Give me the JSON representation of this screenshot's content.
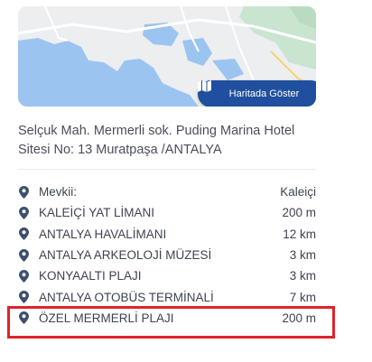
{
  "map": {
    "button_label": "Haritada Göster",
    "button_icon": "map-icon",
    "colors": {
      "water": "#9cc4f0",
      "land": "#eceef0",
      "green": "#c9e4cf",
      "button": "#1f4f9e"
    }
  },
  "address": {
    "line1": "Selçuk Mah. Mermerli sok. Puding Marina Hotel",
    "line2": "Sitesi No: 13 Muratpaşa /ANTALYA"
  },
  "locations": [
    {
      "name": "Mevkii:",
      "value": "Kaleiçi",
      "icon": "location-pin-icon"
    },
    {
      "name": "KALEİÇİ YAT LİMANI",
      "value": "200 m",
      "icon": "location-pin-icon"
    },
    {
      "name": "ANTALYA HAVALİMANI",
      "value": "12 km",
      "icon": "location-pin-icon"
    },
    {
      "name": "ANTALYA ARKEOLOJİ MÜZESİ",
      "value": "3 km",
      "icon": "location-pin-icon"
    },
    {
      "name": "KONYAALTI PLAJI",
      "value": "3 km",
      "icon": "location-pin-icon"
    },
    {
      "name": "ANTALYA OTOBÜS TERMİNALİ",
      "value": "7 km",
      "icon": "location-pin-icon"
    },
    {
      "name": "ÖZEL MERMERLİ PLAJI",
      "value": "200 m",
      "icon": "location-pin-icon"
    }
  ],
  "highlight_color": "#e0222b"
}
